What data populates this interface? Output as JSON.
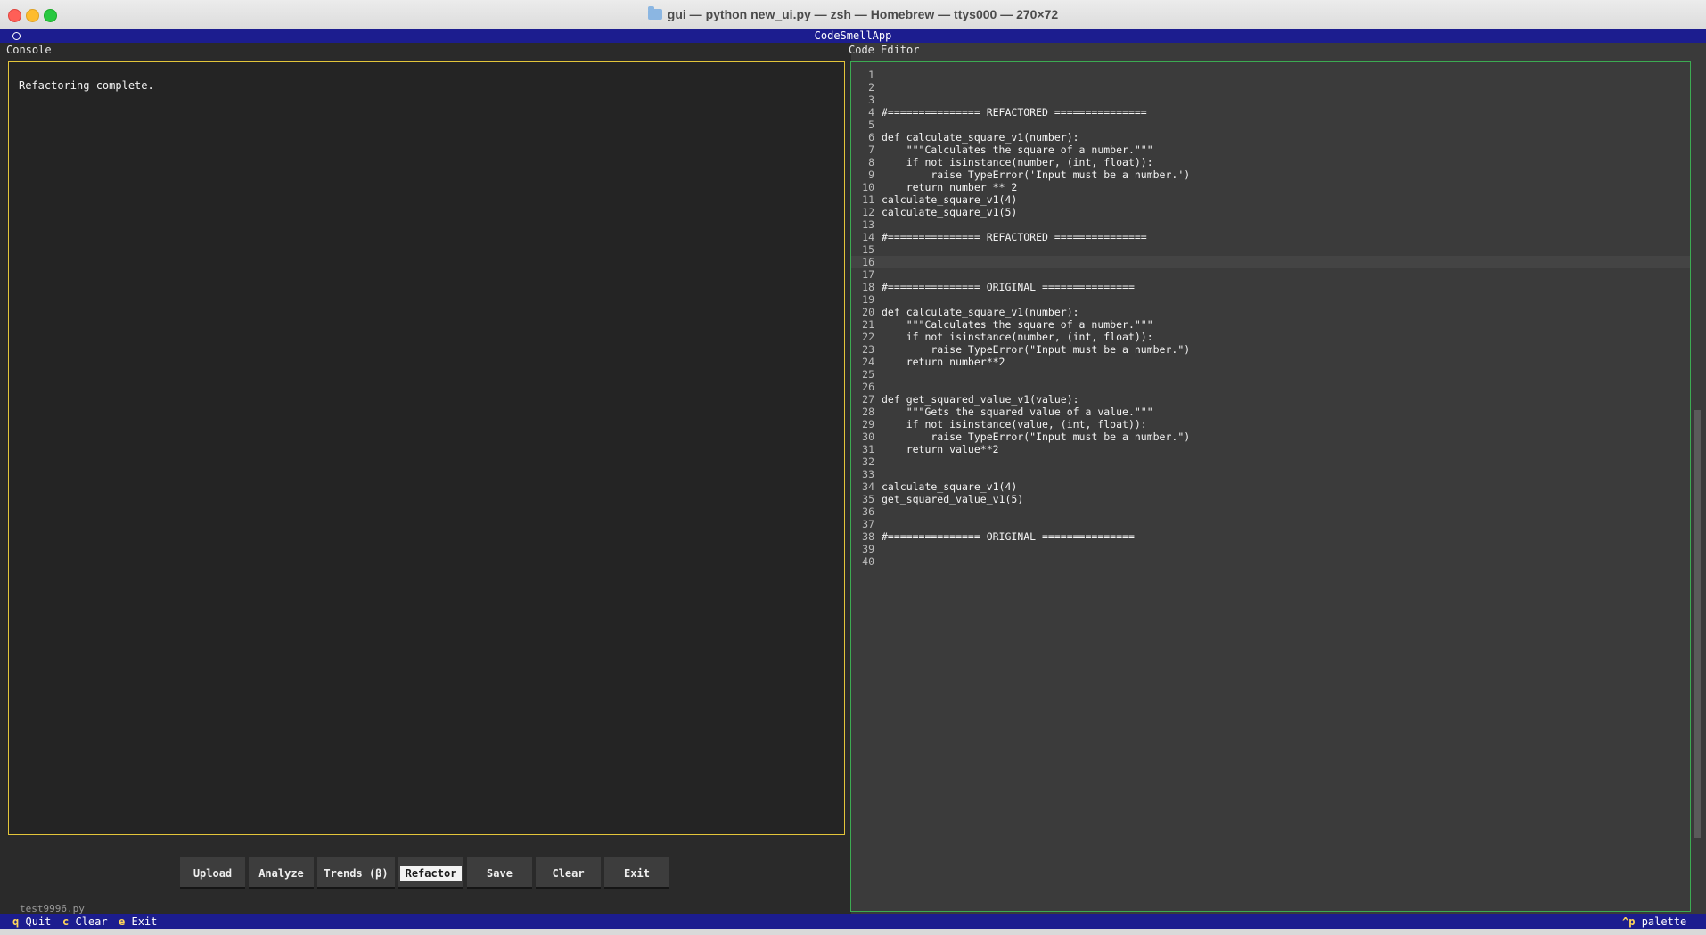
{
  "window": {
    "title": "gui — python new_ui.py — zsh — Homebrew — ttys000 — 270×72"
  },
  "app": {
    "title": "CodeSmellApp"
  },
  "console": {
    "label": "Console",
    "message": "Refactoring complete."
  },
  "editor": {
    "label": "Code Editor",
    "current_line": 16,
    "lines": [
      {
        "n": "1",
        "text": ""
      },
      {
        "n": "2",
        "text": ""
      },
      {
        "n": "3",
        "text": ""
      },
      {
        "n": "4",
        "text": "#=============== REFACTORED ==============="
      },
      {
        "n": "5",
        "text": ""
      },
      {
        "n": "6",
        "text": "def calculate_square_v1(number):"
      },
      {
        "n": "7",
        "text": "    \"\"\"Calculates the square of a number.\"\"\""
      },
      {
        "n": "8",
        "text": "    if not isinstance(number, (int, float)):"
      },
      {
        "n": "9",
        "text": "        raise TypeError('Input must be a number.')"
      },
      {
        "n": "10",
        "text": "    return number ** 2"
      },
      {
        "n": "11",
        "text": "calculate_square_v1(4)"
      },
      {
        "n": "12",
        "text": "calculate_square_v1(5)"
      },
      {
        "n": "13",
        "text": ""
      },
      {
        "n": "14",
        "text": "#=============== REFACTORED ==============="
      },
      {
        "n": "15",
        "text": ""
      },
      {
        "n": "16",
        "text": ""
      },
      {
        "n": "17",
        "text": ""
      },
      {
        "n": "18",
        "text": "#=============== ORIGINAL ==============="
      },
      {
        "n": "19",
        "text": ""
      },
      {
        "n": "20",
        "text": "def calculate_square_v1(number):"
      },
      {
        "n": "21",
        "text": "    \"\"\"Calculates the square of a number.\"\"\""
      },
      {
        "n": "22",
        "text": "    if not isinstance(number, (int, float)):"
      },
      {
        "n": "23",
        "text": "        raise TypeError(\"Input must be a number.\")"
      },
      {
        "n": "24",
        "text": "    return number**2"
      },
      {
        "n": "25",
        "text": ""
      },
      {
        "n": "26",
        "text": ""
      },
      {
        "n": "27",
        "text": "def get_squared_value_v1(value):"
      },
      {
        "n": "28",
        "text": "    \"\"\"Gets the squared value of a value.\"\"\""
      },
      {
        "n": "29",
        "text": "    if not isinstance(value, (int, float)):"
      },
      {
        "n": "30",
        "text": "        raise TypeError(\"Input must be a number.\")"
      },
      {
        "n": "31",
        "text": "    return value**2"
      },
      {
        "n": "32",
        "text": ""
      },
      {
        "n": "33",
        "text": ""
      },
      {
        "n": "34",
        "text": "calculate_square_v1(4)"
      },
      {
        "n": "35",
        "text": "get_squared_value_v1(5)"
      },
      {
        "n": "36",
        "text": ""
      },
      {
        "n": "37",
        "text": ""
      },
      {
        "n": "38",
        "text": "#=============== ORIGINAL ==============="
      },
      {
        "n": "39",
        "text": ""
      },
      {
        "n": "40",
        "text": ""
      }
    ]
  },
  "buttons": {
    "upload": "Upload",
    "analyze": "Analyze",
    "trends": "Trends (β)",
    "refactor": "Refactor",
    "save": "Save",
    "clear": "Clear",
    "exit": "Exit"
  },
  "status": {
    "filename": "test9996.py"
  },
  "footer": {
    "quit_key": "q",
    "quit_label": "Quit",
    "clear_key": "c",
    "clear_label": "Clear",
    "exit_key": "e",
    "exit_label": "Exit",
    "palette_key": "^p",
    "palette_label": "palette"
  },
  "colors": {
    "header_bg": "#1c1d8f",
    "console_border": "#e3c53a",
    "editor_border": "#3cab52"
  }
}
